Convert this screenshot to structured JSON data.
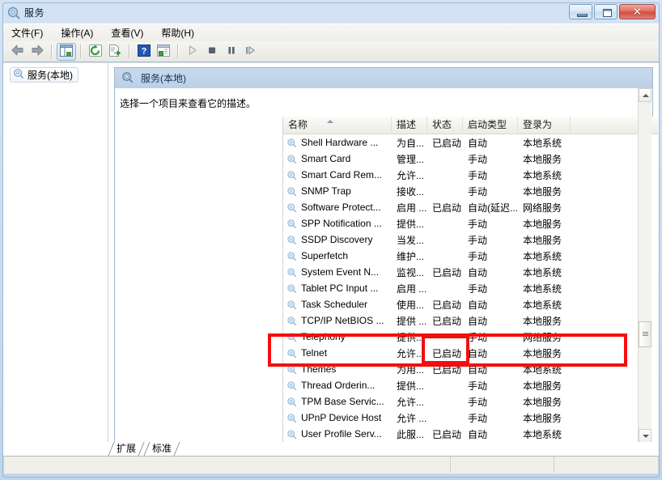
{
  "window": {
    "title": "服务",
    "icon": "services-icon",
    "controls": {
      "minimize_label": "",
      "maximize_label": "",
      "close_label": "✕"
    }
  },
  "menubar": {
    "items": [
      {
        "label": "文件(F)",
        "name": "menu-file"
      },
      {
        "label": "操作(A)",
        "name": "menu-action"
      },
      {
        "label": "查看(V)",
        "name": "menu-view"
      },
      {
        "label": "帮助(H)",
        "name": "menu-help"
      }
    ]
  },
  "toolbar": {
    "buttons": [
      {
        "name": "back-button",
        "icon": "arrow-left-icon"
      },
      {
        "name": "forward-button",
        "icon": "arrow-right-icon"
      },
      {
        "name": "show-hide-tree-button",
        "icon": "tree-panel-icon"
      },
      {
        "name": "refresh-button",
        "icon": "refresh-icon"
      },
      {
        "name": "export-list-button",
        "icon": "export-icon"
      },
      {
        "name": "help-button",
        "icon": "question-mark-icon"
      },
      {
        "name": "properties-button",
        "icon": "properties-icon"
      },
      {
        "name": "start-service-button",
        "icon": "play-icon"
      },
      {
        "name": "stop-service-button",
        "icon": "stop-icon"
      },
      {
        "name": "pause-service-button",
        "icon": "pause-icon"
      },
      {
        "name": "restart-service-button",
        "icon": "restart-icon"
      }
    ]
  },
  "tree": {
    "root_label": "服务(本地)",
    "root_icon": "services-icon"
  },
  "detail": {
    "header_label": "服务(本地)",
    "header_icon": "services-icon",
    "description_placeholder": "选择一个项目来查看它的描述。"
  },
  "list": {
    "columns": [
      {
        "label": "名称",
        "name": "column-name",
        "sorted": true
      },
      {
        "label": "描述",
        "name": "column-description"
      },
      {
        "label": "状态",
        "name": "column-status"
      },
      {
        "label": "启动类型",
        "name": "column-startup-type"
      },
      {
        "label": "登录为",
        "name": "column-log-on-as"
      },
      {
        "label": "",
        "name": "column-filler"
      }
    ],
    "rows": [
      {
        "name": "Shell Hardware ...",
        "description": "为自...",
        "status": "已启动",
        "startup": "自动",
        "logon": "本地系统"
      },
      {
        "name": "Smart Card",
        "description": "管理...",
        "status": "",
        "startup": "手动",
        "logon": "本地服务"
      },
      {
        "name": "Smart Card Rem...",
        "description": "允许...",
        "status": "",
        "startup": "手动",
        "logon": "本地系统"
      },
      {
        "name": "SNMP Trap",
        "description": "接收...",
        "status": "",
        "startup": "手动",
        "logon": "本地服务"
      },
      {
        "name": "Software Protect...",
        "description": "启用 ...",
        "status": "已启动",
        "startup": "自动(延迟...",
        "logon": "网络服务"
      },
      {
        "name": "SPP Notification ...",
        "description": "提供...",
        "status": "",
        "startup": "手动",
        "logon": "本地服务"
      },
      {
        "name": "SSDP Discovery",
        "description": "当发...",
        "status": "",
        "startup": "手动",
        "logon": "本地服务"
      },
      {
        "name": "Superfetch",
        "description": "维护...",
        "status": "",
        "startup": "手动",
        "logon": "本地系统"
      },
      {
        "name": "System Event N...",
        "description": "监视...",
        "status": "已启动",
        "startup": "自动",
        "logon": "本地系统"
      },
      {
        "name": "Tablet PC Input ...",
        "description": "启用 ...",
        "status": "",
        "startup": "手动",
        "logon": "本地系统"
      },
      {
        "name": "Task Scheduler",
        "description": "使用...",
        "status": "已启动",
        "startup": "自动",
        "logon": "本地系统"
      },
      {
        "name": "TCP/IP NetBIOS ...",
        "description": "提供 ...",
        "status": "已启动",
        "startup": "自动",
        "logon": "本地服务"
      },
      {
        "name": "Telephony",
        "description": "提供...",
        "status": "",
        "startup": "手动",
        "logon": "网络服务"
      },
      {
        "name": "Telnet",
        "description": "允许...",
        "status": "已启动",
        "startup": "自动",
        "logon": "本地服务"
      },
      {
        "name": "Themes",
        "description": "为用...",
        "status": "已启动",
        "startup": "自动",
        "logon": "本地系统"
      },
      {
        "name": "Thread Orderin...",
        "description": "提供...",
        "status": "",
        "startup": "手动",
        "logon": "本地服务"
      },
      {
        "name": "TPM Base Servic...",
        "description": "允许...",
        "status": "",
        "startup": "手动",
        "logon": "本地服务"
      },
      {
        "name": "UPnP Device Host",
        "description": "允许 ...",
        "status": "",
        "startup": "手动",
        "logon": "本地服务"
      },
      {
        "name": "User Profile Serv...",
        "description": "此服...",
        "status": "已启动",
        "startup": "自动",
        "logon": "本地系统"
      }
    ]
  },
  "annotation": {
    "color": "#f20f0f",
    "highlighted_row": "Telnet",
    "highlighted_cell": "已启动"
  },
  "tabs": [
    {
      "label": "扩展",
      "name": "tab-extended",
      "selected": false
    },
    {
      "label": "标准",
      "name": "tab-standard",
      "selected": true
    }
  ],
  "statusbar": {
    "pane1": "",
    "pane2": "",
    "pane3": ""
  }
}
